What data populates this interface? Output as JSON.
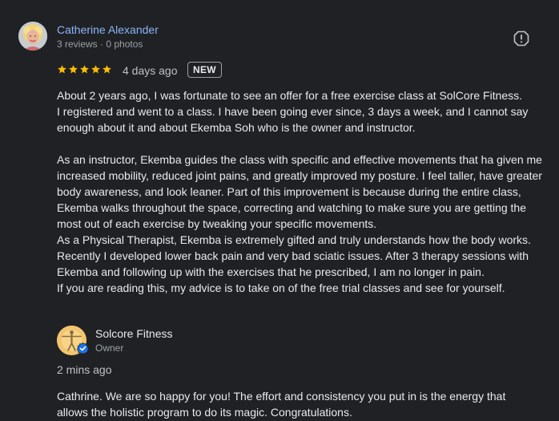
{
  "review": {
    "reviewer_name": "Catherine Alexander",
    "reviewer_meta": "3 reviews · 0 photos",
    "rating": 5,
    "rating_max": 5,
    "date": "4 days ago",
    "badge": "NEW",
    "paragraphs": [
      "About 2 years ago, I was fortunate to see an offer for a free exercise class at SolCore Fitness.\nI registered and went to a class. I have been going ever since, 3 days a week, and I cannot say enough about it and about Ekemba Soh who is the owner and instructor.",
      "As an instructor, Ekemba guides the class with specific and effective movements that ha given me increased mobility, reduced joint pains, and greatly improved my posture. I feel taller, have greater body awareness, and look leaner. Part of this improvement is because during the entire class, Ekemba walks throughout the space, correcting and watching to make sure you are getting the most out of each exercise by tweaking your specific movements.\nAs a Physical Therapist, Ekemba is extremely gifted and truly understands how the body works. Recently I developed lower back pain and very bad sciatic issues. After 3 therapy sessions with Ekemba and following up with the exercises that he prescribed, I am no longer in pain.\nIf you are reading this, my advice is to take on of the free trial classes and see for yourself."
    ],
    "star_color": "#fbbc04"
  },
  "owner_reply": {
    "name": "Solcore Fitness",
    "role": "Owner",
    "date": "2 mins ago",
    "text": "Cathrine. We are so happy for you! The effort and consistency you put in is the energy that allows the holistic program to do its magic. Congratulations."
  },
  "icons": {
    "report": "report-flag-icon",
    "verified": "verified-check-icon",
    "star": "star-icon"
  },
  "colors": {
    "background": "#202124",
    "link": "#8ab4f8",
    "verified": "#1a73e8"
  }
}
